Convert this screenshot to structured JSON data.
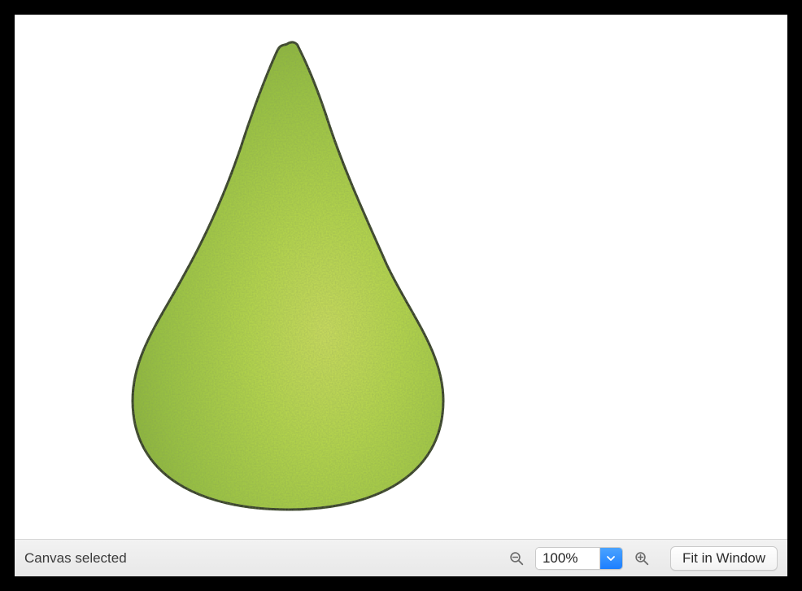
{
  "status": {
    "text": "Canvas selected"
  },
  "zoom": {
    "value": "100%"
  },
  "buttons": {
    "fit": "Fit in Window"
  },
  "canvas": {
    "object": "pear-illustration",
    "fill_light": "#b7d94a",
    "fill_dark": "#8fb93a",
    "outline": "#1e1e1e"
  }
}
